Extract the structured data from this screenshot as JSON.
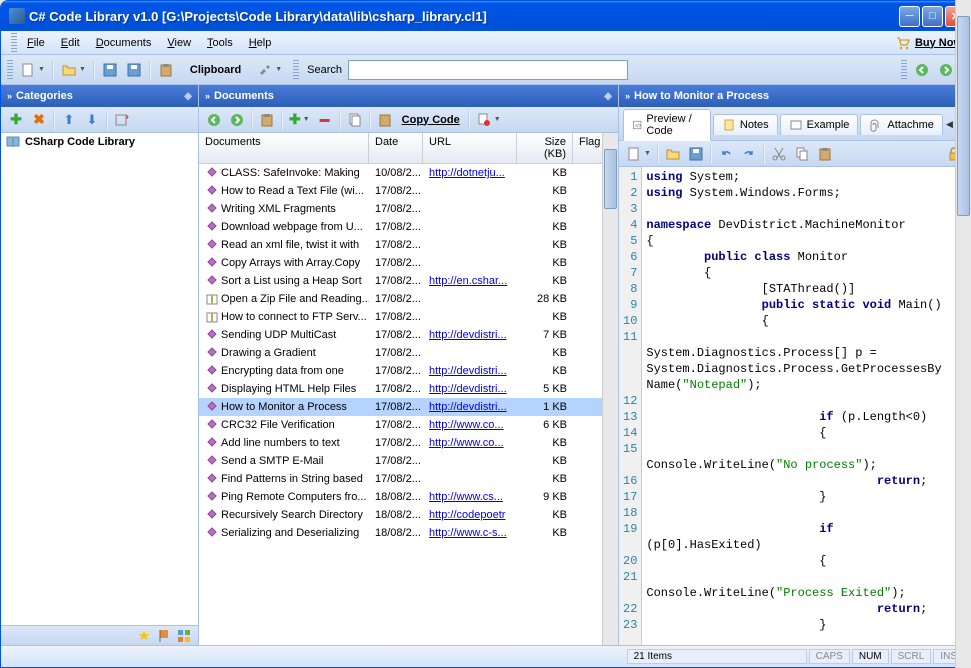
{
  "window": {
    "title": "C# Code Library v1.0  [G:\\Projects\\Code Library\\data\\lib\\csharp_library.cl1]"
  },
  "menus": [
    "File",
    "Edit",
    "Documents",
    "View",
    "Tools",
    "Help"
  ],
  "buy_now": "Buy Now",
  "toolbar": {
    "clipboard": "Clipboard",
    "search_label": "Search",
    "search_value": ""
  },
  "panels": {
    "categories": {
      "title": "Categories",
      "root": "CSharp Code Library"
    },
    "documents": {
      "title": "Documents",
      "copy_code": "Copy Code",
      "columns": [
        "Documents",
        "Date",
        "URL",
        "Size (KB)",
        "Flag"
      ],
      "rows": [
        {
          "title": "CLASS: SafeInvoke: Making",
          "date": "10/08/2...",
          "url": "http://dotnetju...",
          "size": "KB"
        },
        {
          "title": "How to Read a Text File (wi...",
          "date": "17/08/2...",
          "url": "",
          "size": "KB"
        },
        {
          "title": "Writing XML Fragments",
          "date": "17/08/2...",
          "url": "",
          "size": "KB"
        },
        {
          "title": "Download webpage from U...",
          "date": "17/08/2...",
          "url": "",
          "size": "KB"
        },
        {
          "title": "Read an xml file, twist it with",
          "date": "17/08/2...",
          "url": "",
          "size": "KB"
        },
        {
          "title": "Copy Arrays with Array.Copy",
          "date": "17/08/2...",
          "url": "",
          "size": "KB"
        },
        {
          "title": "Sort a List using a Heap Sort",
          "date": "17/08/2...",
          "url": "http://en.cshar...",
          "size": "KB"
        },
        {
          "title": "Open a Zip File and Reading...",
          "date": "17/08/2...",
          "url": "",
          "size": "28 KB"
        },
        {
          "title": "How to connect to FTP Serv...",
          "date": "17/08/2...",
          "url": "",
          "size": "KB"
        },
        {
          "title": "Sending UDP MultiCast",
          "date": "17/08/2...",
          "url": "http://devdistri...",
          "size": "7 KB"
        },
        {
          "title": "Drawing a Gradient",
          "date": "17/08/2...",
          "url": "",
          "size": "KB"
        },
        {
          "title": "Encrypting data from one",
          "date": "17/08/2...",
          "url": "http://devdistri...",
          "size": "KB"
        },
        {
          "title": "Displaying HTML Help Files",
          "date": "17/08/2...",
          "url": "http://devdistri...",
          "size": "5 KB"
        },
        {
          "title": "How to Monitor a Process",
          "date": "17/08/2...",
          "url": "http://devdistri...",
          "size": "1 KB",
          "selected": true
        },
        {
          "title": "CRC32 File Verification",
          "date": "17/08/2...",
          "url": "http://www.co...",
          "size": "6 KB"
        },
        {
          "title": "Add line numbers to text",
          "date": "17/08/2...",
          "url": "http://www.co...",
          "size": "KB"
        },
        {
          "title": "Send a SMTP E-Mail",
          "date": "17/08/2...",
          "url": "",
          "size": "KB"
        },
        {
          "title": "Find Patterns in String based",
          "date": "17/08/2...",
          "url": "",
          "size": "KB"
        },
        {
          "title": "Ping Remote Computers fro...",
          "date": "18/08/2...",
          "url": "http://www.cs...",
          "size": "9 KB"
        },
        {
          "title": "Recursively Search Directory",
          "date": "18/08/2...",
          "url": "http://codepoetr",
          "size": "KB"
        },
        {
          "title": "Serializing and Deserializing",
          "date": "18/08/2...",
          "url": "http://www.c-s...",
          "size": "KB"
        }
      ]
    },
    "code": {
      "title": "How to Monitor a Process",
      "tabs": [
        "Preview / Code",
        "Notes",
        "Example",
        "Attachme"
      ],
      "lines": [
        [
          {
            "t": "using",
            "c": "kw"
          },
          {
            "t": " System;"
          }
        ],
        [
          {
            "t": "using",
            "c": "kw"
          },
          {
            "t": " System.Windows.Forms;"
          }
        ],
        [],
        [
          {
            "t": "namespace",
            "c": "kw"
          },
          {
            "t": " DevDistrict.MachineMonitor"
          }
        ],
        [
          {
            "t": "{"
          }
        ],
        [
          {
            "t": "        "
          },
          {
            "t": "public class",
            "c": "kw"
          },
          {
            "t": " Monitor"
          }
        ],
        [
          {
            "t": "        {"
          }
        ],
        [
          {
            "t": "                [STAThread()]"
          }
        ],
        [
          {
            "t": "                "
          },
          {
            "t": "public static void",
            "c": "kw"
          },
          {
            "t": " Main()"
          }
        ],
        [
          {
            "t": "                {"
          }
        ],
        [],
        [
          {
            "t": "System.Diagnostics.Process[] p ="
          }
        ],
        [
          {
            "t": "System.Diagnostics.Process.GetProcessesBy"
          }
        ],
        [
          {
            "t": "Name("
          },
          {
            "t": "\"Notepad\"",
            "c": "str"
          },
          {
            "t": ");"
          }
        ],
        [],
        [
          {
            "t": "                        "
          },
          {
            "t": "if",
            "c": "kw"
          },
          {
            "t": " (p.Length<0)"
          }
        ],
        [
          {
            "t": "                        {"
          }
        ],
        [],
        [
          {
            "t": "Console.WriteLine("
          },
          {
            "t": "\"No process\"",
            "c": "str"
          },
          {
            "t": ");"
          }
        ],
        [
          {
            "t": "                                "
          },
          {
            "t": "return",
            "c": "kw"
          },
          {
            "t": ";"
          }
        ],
        [
          {
            "t": "                        }"
          }
        ],
        [],
        [
          {
            "t": "                        "
          },
          {
            "t": "if",
            "c": "kw"
          }
        ],
        [
          {
            "t": "(p[0].HasExited)"
          }
        ],
        [
          {
            "t": "                        {"
          }
        ],
        [],
        [
          {
            "t": "Console.WriteLine("
          },
          {
            "t": "\"Process Exited\"",
            "c": "str"
          },
          {
            "t": ");"
          }
        ],
        [
          {
            "t": "                                "
          },
          {
            "t": "return",
            "c": "kw"
          },
          {
            "t": ";"
          }
        ],
        [
          {
            "t": "                        }"
          }
        ]
      ],
      "line_nums": [
        1,
        2,
        3,
        4,
        5,
        6,
        7,
        8,
        9,
        10,
        11,
        "",
        "",
        "",
        12,
        13,
        14,
        15,
        "",
        16,
        17,
        18,
        19,
        "",
        20,
        21,
        "",
        22,
        23
      ]
    }
  },
  "status": {
    "items": "21 Items",
    "caps": "CAPS",
    "num": "NUM",
    "scrl": "SCRL",
    "ins": "INS"
  }
}
